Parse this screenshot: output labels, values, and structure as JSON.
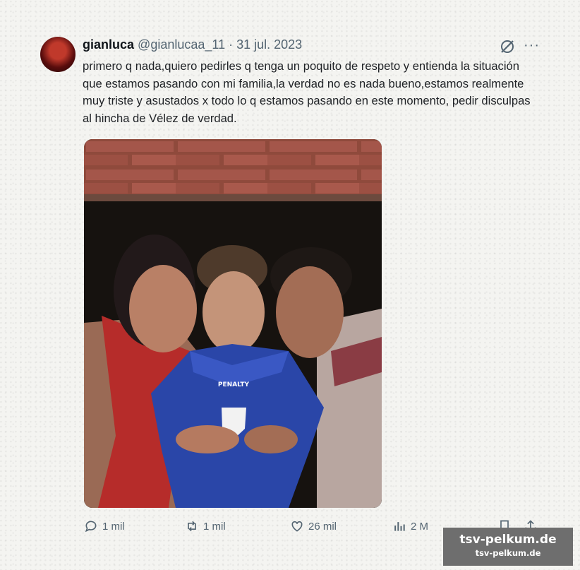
{
  "tweet": {
    "author_name": "gianluca",
    "handle": "@gianlucaa_11",
    "separator": "·",
    "date": "31 jul. 2023",
    "more_glyph": "···",
    "text": "primero q nada,quiero pedirles q tenga un poquito de respeto y entienda la situación que estamos pasando con mi familia,la verdad no es nada bueno,estamos realmente muy triste y asustados x todo lo q estamos pasando en este momento, pedir disculpas al hincha de Vélez de verdad."
  },
  "photo": {
    "shirt_text": "PENALTY"
  },
  "actions": {
    "replies": "1 mil",
    "retweets": "1 mil",
    "likes": "26 mil",
    "views": "2 M"
  },
  "watermark": {
    "main": "tsv-pelkum.de",
    "sub": "tsv-pelkum.de"
  },
  "icons": [
    "reply-icon",
    "retweet-icon",
    "like-icon",
    "views-icon",
    "bookmark-icon",
    "share-icon",
    "grok-icon",
    "more-icon"
  ]
}
